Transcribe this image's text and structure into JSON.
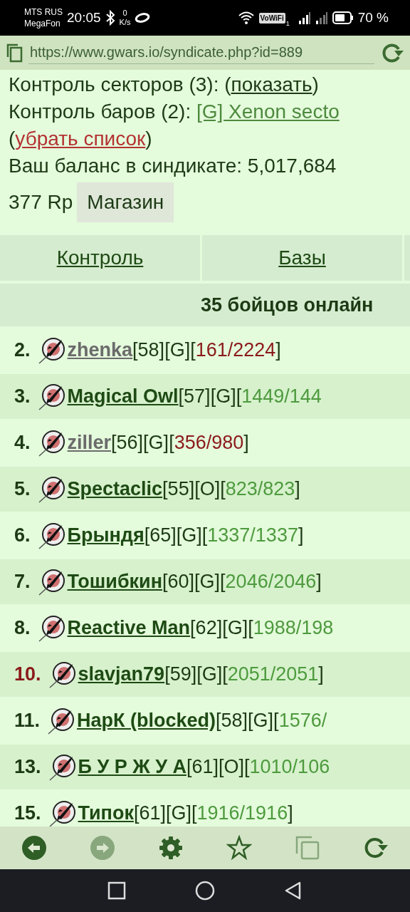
{
  "status_bar": {
    "carriers": [
      "MTS RUS",
      "MegaFon"
    ],
    "time": "20:05",
    "speed_value": "0",
    "speed_unit": "K/s",
    "vowifi": "VoWiFi",
    "sim": "1",
    "battery": "70 %"
  },
  "address_bar": {
    "url": "https://www.gwars.io/syndicate.php?id=889"
  },
  "summary": [
    {
      "segments": [
        {
          "kind": "text",
          "text": "Контроль секторов (3): ("
        },
        {
          "kind": "link",
          "text": "показать"
        },
        {
          "kind": "text",
          "text": ")"
        }
      ]
    },
    {
      "segments": [
        {
          "kind": "text",
          "text": "Контроль баров (2): "
        },
        {
          "kind": "bar_link",
          "text": "[G] Xenon secto"
        }
      ]
    },
    {
      "segments": [
        {
          "kind": "text",
          "text": "("
        },
        {
          "kind": "remove_link",
          "text": "убрать список"
        },
        {
          "kind": "text",
          "text": ")"
        }
      ]
    },
    {
      "segments": [
        {
          "kind": "text",
          "text": "Ваш баланс в синдикате: 5,017,684"
        }
      ]
    }
  ],
  "rp": "377 Rp",
  "shop_button": "Магазин",
  "tabs": [
    {
      "label": "Контроль"
    },
    {
      "label": "Базы"
    }
  ],
  "online_header": "35 бойцов онлайн",
  "fighters": [
    {
      "number": "2.",
      "name": "zhenka",
      "idle": true,
      "highlight": false,
      "level": "[58]",
      "faction": "[G]",
      "hp_open": "[",
      "hp": "161/2224",
      "hp_full": false,
      "hp_close": "]"
    },
    {
      "number": "3.",
      "name": "Magical Owl",
      "idle": false,
      "highlight": false,
      "level": "[57]",
      "faction": "[G]",
      "hp_open": "[",
      "hp": "1449/144",
      "hp_full": true
    },
    {
      "number": "4.",
      "name": "ziller",
      "idle": true,
      "highlight": false,
      "level": "[56]",
      "faction": "[G]",
      "hp_open": "[",
      "hp": "356/980",
      "hp_full": false,
      "hp_close": "]"
    },
    {
      "number": "5.",
      "name": "Spectaclic",
      "idle": false,
      "highlight": false,
      "level": "[55]",
      "faction": "[O]",
      "hp_open": "[",
      "hp": "823/823",
      "hp_full": true,
      "hp_close": "]"
    },
    {
      "number": "6.",
      "name": "Брындя",
      "idle": false,
      "highlight": false,
      "level": "[65]",
      "faction": "[G]",
      "hp_open": "[",
      "hp": "1337/1337",
      "hp_full": true,
      "hp_close": "]"
    },
    {
      "number": "7.",
      "name": "Тошибкин",
      "idle": false,
      "highlight": false,
      "level": "[60]",
      "faction": "[G]",
      "hp_open": "[",
      "hp": "2046/2046",
      "hp_full": true,
      "hp_close": "]"
    },
    {
      "number": "8.",
      "name": "Reactive Man",
      "idle": false,
      "highlight": false,
      "level": "[62]",
      "faction": "[G]",
      "hp_open": "[",
      "hp": "1988/198",
      "hp_full": true
    },
    {
      "number": "10.",
      "name": "slavjan79",
      "idle": false,
      "highlight": true,
      "level": "[59]",
      "faction": "[G]",
      "hp_open": "[",
      "hp": "2051/2051",
      "hp_full": true,
      "hp_close": "]"
    },
    {
      "number": "11.",
      "name": "НарК (blocked)",
      "idle": false,
      "highlight": false,
      "level": "[58]",
      "faction": "[G]",
      "hp_open": "[",
      "hp": "1576/",
      "hp_full": true
    },
    {
      "number": "13.",
      "name": "Б У Р Ж У А",
      "idle": false,
      "highlight": false,
      "level": "[61]",
      "faction": "[O]",
      "hp_open": "[",
      "hp": "1010/106",
      "hp_full": true
    },
    {
      "number": "15.",
      "name": "Типок",
      "idle": false,
      "highlight": false,
      "level": "[61]",
      "faction": "[G]",
      "hp_open": "[",
      "hp": "1916/1916",
      "hp_full": true,
      "hp_close": "]"
    }
  ],
  "toolbar": [
    {
      "kind": "back",
      "disabled": false
    },
    {
      "kind": "forward",
      "disabled": true
    },
    {
      "kind": "settings",
      "disabled": false
    },
    {
      "kind": "bookmark",
      "disabled": false
    },
    {
      "kind": "tabs",
      "disabled": true
    },
    {
      "kind": "reload",
      "disabled": false
    }
  ],
  "nav_bar": [
    {
      "kind": "recent"
    },
    {
      "kind": "home"
    },
    {
      "kind": "back"
    }
  ]
}
